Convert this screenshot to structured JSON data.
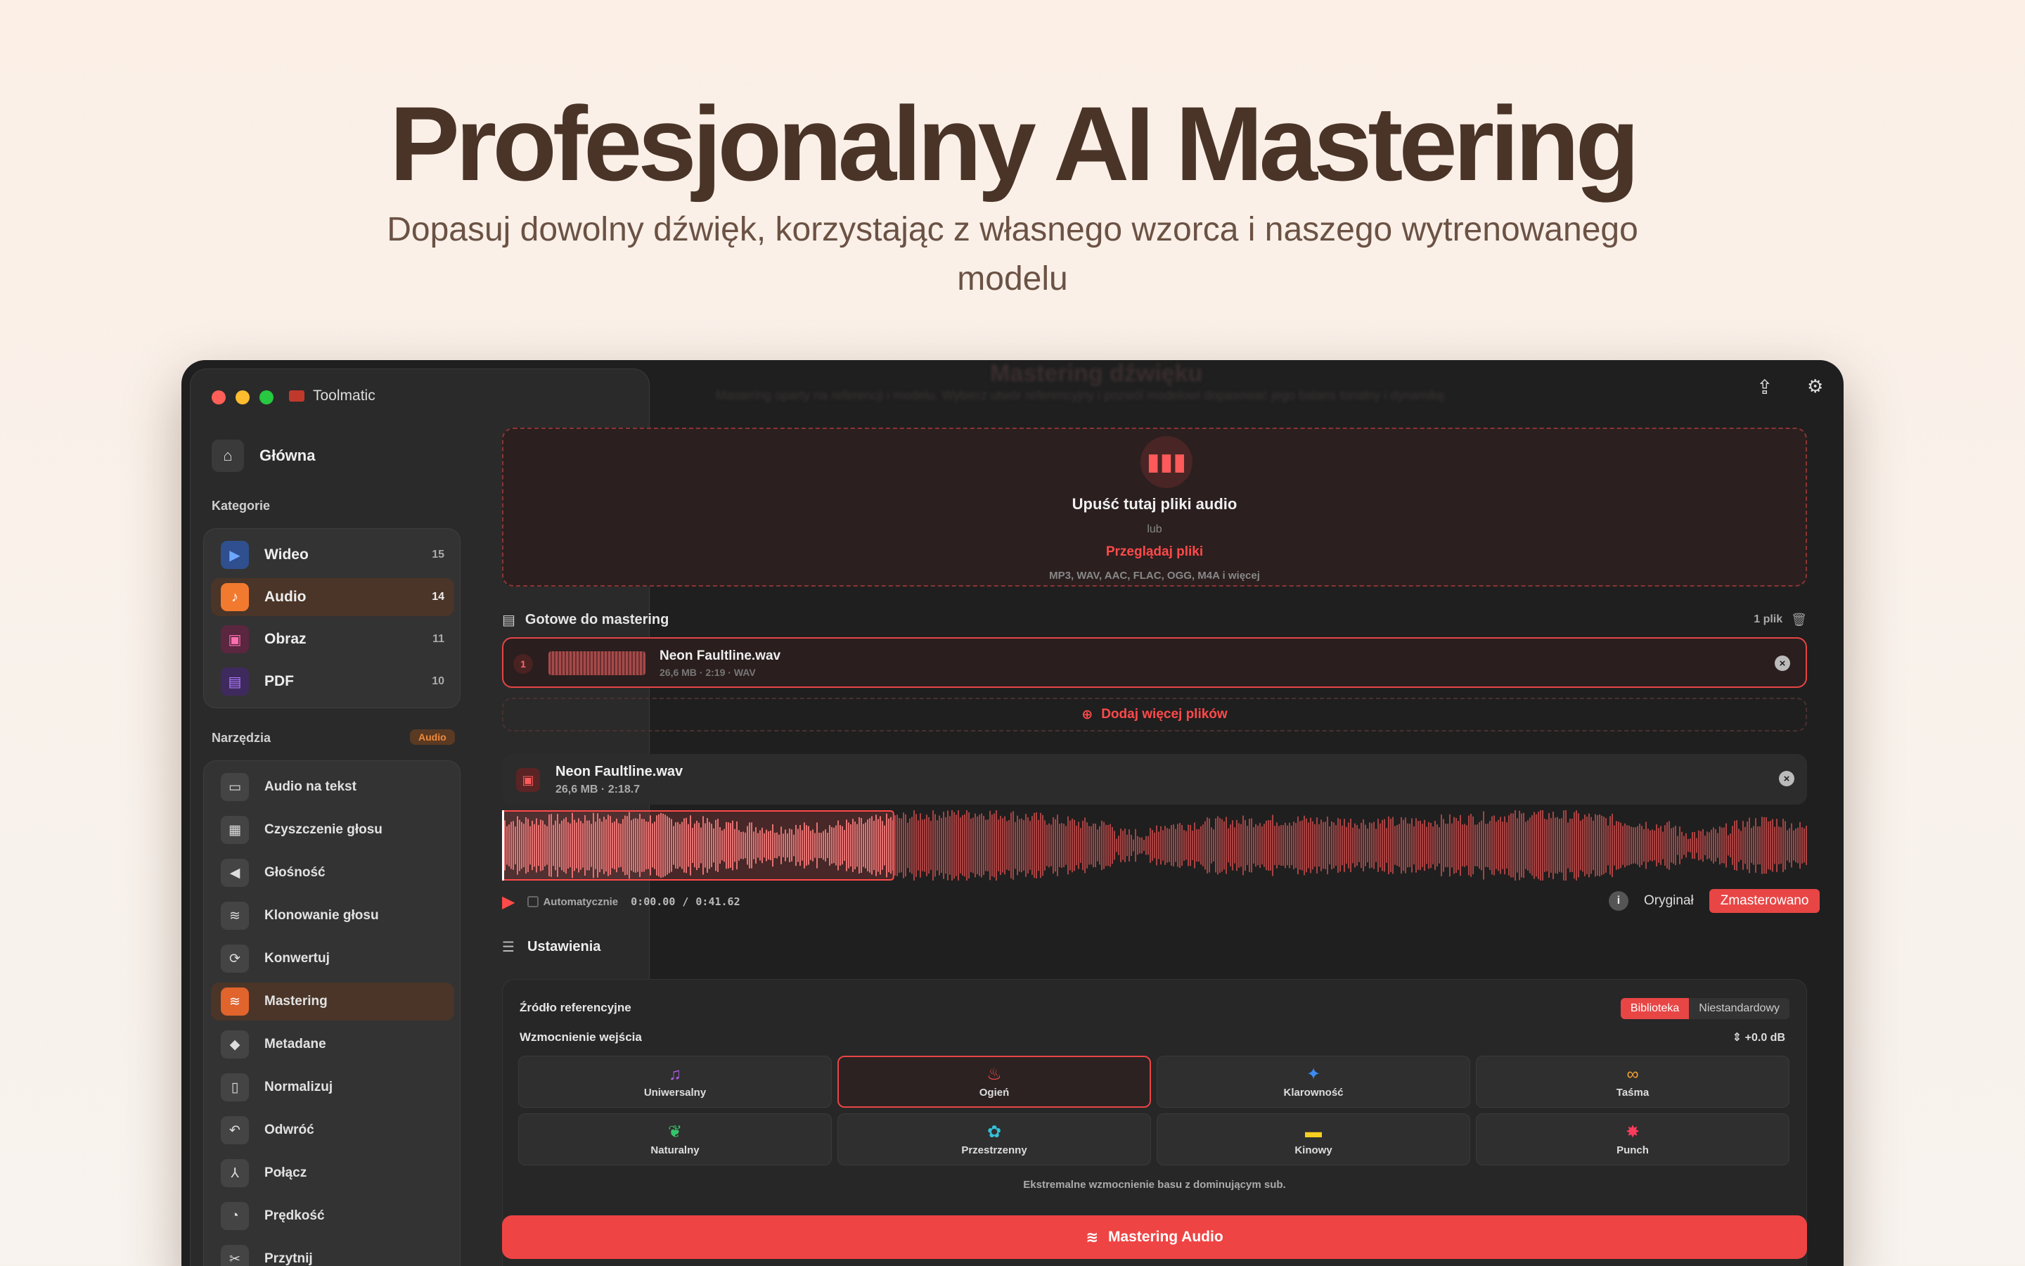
{
  "hero": {
    "title": "Profesjonalny AI Mastering",
    "subtitle": "Dopasuj dowolny dźwięk, korzystając z własnego wzorca i naszego wytrenowanego modelu"
  },
  "app": {
    "name": "Toolmatic"
  },
  "sidebar": {
    "home_label": "Główna",
    "categories_label": "Kategorie",
    "categories": [
      {
        "label": "Wideo",
        "count": "15",
        "icon": "video-icon",
        "color": "#2f6fe0"
      },
      {
        "label": "Audio",
        "count": "14",
        "icon": "music-note-icon",
        "color": "#f27a2e"
      },
      {
        "label": "Obraz",
        "count": "11",
        "icon": "image-icon",
        "color": "#d63384"
      },
      {
        "label": "PDF",
        "count": "10",
        "icon": "document-icon",
        "color": "#8a3fd9"
      }
    ],
    "tools_label": "Narzędzia",
    "tools_badge": "Audio",
    "tools": [
      {
        "label": "Audio na tekst",
        "icon": "speech-bubble-icon"
      },
      {
        "label": "Czyszczenie głosu",
        "icon": "noise-clean-icon"
      },
      {
        "label": "Głośność",
        "icon": "speaker-icon"
      },
      {
        "label": "Klonowanie głosu",
        "icon": "voice-wave-icon"
      },
      {
        "label": "Konwertuj",
        "icon": "convert-icon"
      },
      {
        "label": "Mastering",
        "icon": "mastering-icon"
      },
      {
        "label": "Metadane",
        "icon": "tag-icon"
      },
      {
        "label": "Normalizuj",
        "icon": "normalize-icon"
      },
      {
        "label": "Odwróć",
        "icon": "reverse-icon"
      },
      {
        "label": "Połącz",
        "icon": "merge-icon"
      },
      {
        "label": "Prędkość",
        "icon": "speed-icon"
      },
      {
        "label": "Przytnij",
        "icon": "scissors-icon"
      }
    ]
  },
  "main": {
    "ghost_title": "Mastering dźwięku",
    "ghost_subtitle": "Mastering oparty na referencji i modelu. Wybierz utwór referencyjny i pozwól modelowi dopasować jego balans tonalny i dynamikę.",
    "dropzone": {
      "title": "Upuść tutaj pliki audio",
      "or": "lub",
      "browse": "Przeglądaj pliki",
      "formats": "MP3, WAV, AAC, FLAC, OGG, M4A i więcej"
    },
    "ready": {
      "label": "Gotowe do mastering",
      "count": "1 plik"
    },
    "file": {
      "index": "1",
      "name": "Neon Faultline.wav",
      "meta": "26,6 MB · 2:19 · WAV"
    },
    "add_more": "Dodaj więcej plików",
    "player": {
      "name": "Neon Faultline.wav",
      "size": "26,6 MB",
      "duration": "2:18.7",
      "auto_label": "Automatycznie",
      "time_current": "0:00.00",
      "time_sep": "/",
      "time_total": "0:41.62",
      "seg_original": "Oryginał",
      "seg_mastered": "Zmasterowano",
      "selection_start": 0,
      "selection_end": 0.3
    },
    "settings": {
      "title": "Ustawienia",
      "ref_source_label": "Źródło referencyjne",
      "ref_library": "Biblioteka",
      "ref_custom": "Niestandardowy",
      "gain_label": "Wzmocnienie wejścia",
      "gain_value": "+0.0 dB",
      "presets": [
        {
          "label": "Uniwersalny",
          "icon": "music-list-icon",
          "color": "#b05be6"
        },
        {
          "label": "Ogień",
          "icon": "flame-icon",
          "color": "#ff4a4a"
        },
        {
          "label": "Klarowność",
          "icon": "sparkle-icon",
          "color": "#3b8df5"
        },
        {
          "label": "Taśma",
          "icon": "tape-icon",
          "color": "#f0a030"
        },
        {
          "label": "Naturalny",
          "icon": "leaf-icon",
          "color": "#35c46a"
        },
        {
          "label": "Przestrzenny",
          "icon": "spatial-icon",
          "color": "#34c0d8"
        },
        {
          "label": "Kinowy",
          "icon": "film-icon",
          "color": "#f5d020"
        },
        {
          "label": "Punch",
          "icon": "burst-icon",
          "color": "#ff3b5c"
        }
      ],
      "preset_desc": "Ekstremalne wzmocnienie basu z dominującym sub."
    },
    "cta": "Mastering Audio"
  }
}
